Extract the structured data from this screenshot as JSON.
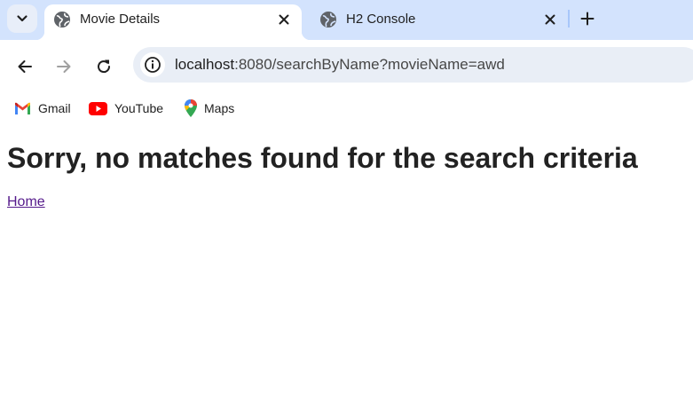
{
  "tabs": [
    {
      "title": "Movie Details",
      "active": true,
      "favicon": "globe-icon"
    },
    {
      "title": "H2 Console",
      "active": false,
      "favicon": "globe-icon"
    }
  ],
  "omnibox": {
    "host": "localhost",
    "path": ":8080/searchByName?movieName=awd"
  },
  "bookmarks": [
    {
      "label": "Gmail",
      "icon": "gmail-icon"
    },
    {
      "label": "YouTube",
      "icon": "youtube-icon"
    },
    {
      "label": "Maps",
      "icon": "maps-icon"
    }
  ],
  "page": {
    "heading": "Sorry, no matches found for the search criteria",
    "home_link": "Home"
  },
  "colors": {
    "tabstrip": "#d3e3fd",
    "omnibox": "#e9eef6",
    "visited_link": "#551a8b"
  }
}
